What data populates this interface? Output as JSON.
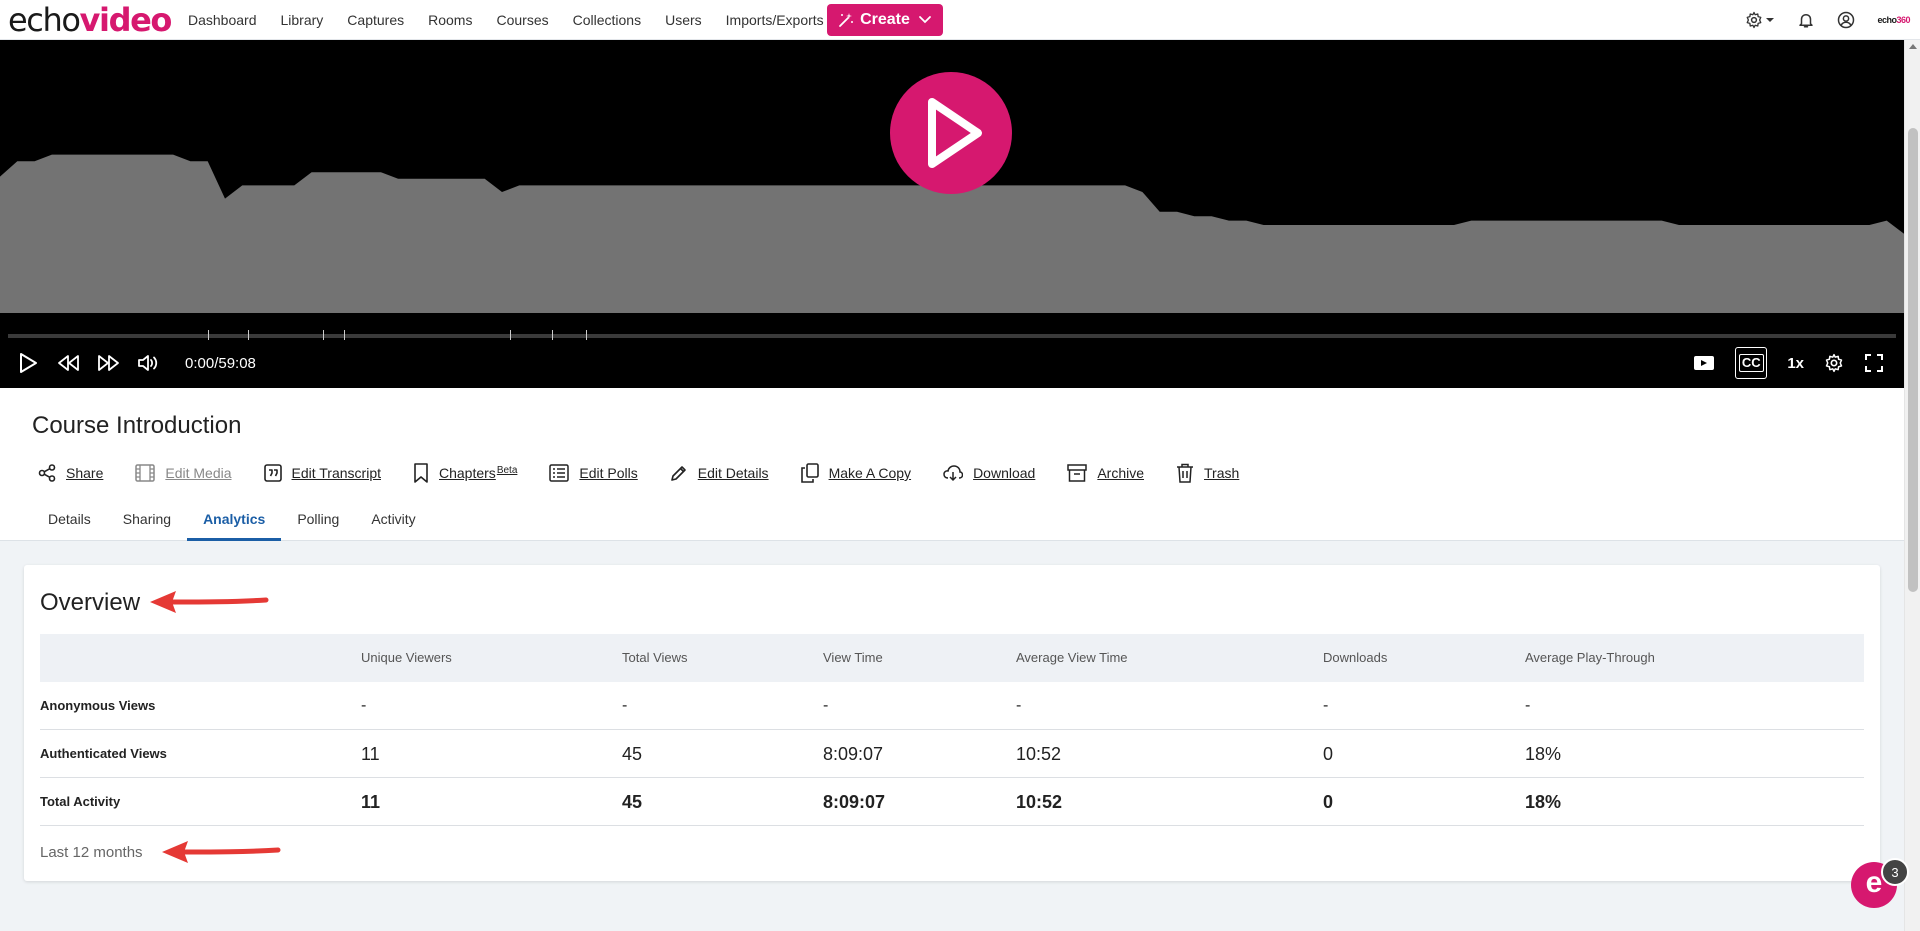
{
  "brand": {
    "echo": "echo",
    "video": "video",
    "mini_echo": "echo",
    "mini_360": "360"
  },
  "nav": {
    "items": [
      "Dashboard",
      "Library",
      "Captures",
      "Rooms",
      "Courses",
      "Collections",
      "Users",
      "Imports/Exports"
    ],
    "create_label": "Create"
  },
  "player": {
    "timecode": "0:00/59:08",
    "speed": "1x",
    "cc_label": "CC",
    "engagement": [
      0.62,
      0.69,
      0.69,
      0.72,
      0.72,
      0.72,
      0.72,
      0.72,
      0.72,
      0.72,
      0.72,
      0.69,
      0.69,
      0.52,
      0.58,
      0.58,
      0.58,
      0.58,
      0.64,
      0.64,
      0.64,
      0.64,
      0.64,
      0.61,
      0.61,
      0.61,
      0.61,
      0.61,
      0.61,
      0.55,
      0.58,
      0.58,
      0.58,
      0.58,
      0.58,
      0.58,
      0.58,
      0.58,
      0.58,
      0.58,
      0.58,
      0.58,
      0.58,
      0.58,
      0.58,
      0.58,
      0.58,
      0.58,
      0.58,
      0.58,
      0.58,
      0.58,
      0.58,
      0.58,
      0.58,
      0.58,
      0.58,
      0.58,
      0.58,
      0.58,
      0.58,
      0.58,
      0.58,
      0.58,
      0.58,
      0.58,
      0.55,
      0.46,
      0.46,
      0.44,
      0.44,
      0.42,
      0.42,
      0.4,
      0.4,
      0.4,
      0.4,
      0.4,
      0.4,
      0.4,
      0.4,
      0.4,
      0.4,
      0.4,
      0.4,
      0.42,
      0.42,
      0.42,
      0.42,
      0.42,
      0.42,
      0.42,
      0.42,
      0.42,
      0.42,
      0.42,
      0.42,
      0.4,
      0.4,
      0.4,
      0.4,
      0.4,
      0.4,
      0.4,
      0.4,
      0.4,
      0.4,
      0.4,
      0.4,
      0.42,
      0.36
    ],
    "markers": [
      0.106,
      0.127,
      0.167,
      0.178,
      0.266,
      0.288,
      0.306
    ]
  },
  "media": {
    "title": "Course Introduction",
    "actions": {
      "share": "Share",
      "edit_media": "Edit Media",
      "edit_transcript": "Edit Transcript",
      "chapters": "Chapters",
      "chapters_badge": "Beta",
      "edit_polls": "Edit Polls",
      "edit_details": "Edit Details",
      "make_copy": "Make A Copy",
      "download": "Download",
      "archive": "Archive",
      "trash": "Trash"
    },
    "tabs": [
      "Details",
      "Sharing",
      "Analytics",
      "Polling",
      "Activity"
    ]
  },
  "overview": {
    "title": "Overview",
    "columns": [
      "Unique Viewers",
      "Total Views",
      "View Time",
      "Average View Time",
      "Downloads",
      "Average Play-Through"
    ],
    "rows": [
      {
        "label": "Anonymous Views",
        "values": [
          "-",
          "-",
          "-",
          "-",
          "-",
          "-"
        ]
      },
      {
        "label": "Authenticated Views",
        "values": [
          "11",
          "45",
          "8:09:07",
          "10:52",
          "0",
          "18%"
        ]
      },
      {
        "label": "Total Activity",
        "values": [
          "11",
          "45",
          "8:09:07",
          "10:52",
          "0",
          "18%"
        ]
      }
    ],
    "period": "Last 12 months"
  },
  "chat": {
    "badge": "3",
    "letter": "e"
  },
  "colors": {
    "accent": "#d6186f",
    "tab_active": "#1b5ea6",
    "arrow": "#e53935"
  }
}
